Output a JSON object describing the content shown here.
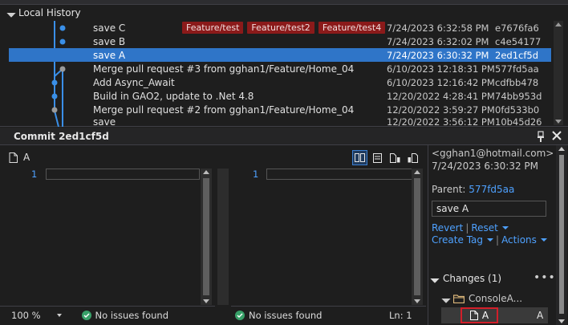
{
  "history": {
    "title": "Local History",
    "commits": [
      {
        "message": "save C",
        "tags": [
          "Feature/test",
          "Feature/test2",
          "Feature/test4"
        ],
        "date": "7/24/2023 6:32:58 PM",
        "sha": "e7676fa6",
        "selected": false
      },
      {
        "message": "save B",
        "tags": [],
        "date": "7/24/2023 6:32:02 PM",
        "sha": "c4e54177",
        "selected": false
      },
      {
        "message": "save A",
        "tags": [],
        "date": "7/24/2023 6:30:32 PM",
        "sha": "2ed1cf5d",
        "selected": true
      },
      {
        "message": "Merge pull request #3 from gghan1/Feature/Home_04",
        "tags": [],
        "date": "6/10/2023 12:18:31 PM",
        "sha": "577fd5aa",
        "selected": false
      },
      {
        "message": "Add Async_Await",
        "tags": [],
        "date": "6/10/2023 12:16:42 PM",
        "sha": "cdfbb478",
        "selected": false
      },
      {
        "message": "Build in GAO2, update to .Net 4.8",
        "tags": [],
        "date": "12/20/2022 4:28:41 PM",
        "sha": "74bb953d",
        "selected": false
      },
      {
        "message": "Merge pull request #2 from gghan1/Feature/Home_04",
        "tags": [],
        "date": "12/20/2022 3:59:27 PM",
        "sha": "0fd533b0",
        "selected": false
      },
      {
        "message": "save",
        "tags": [],
        "date": "12/20/2022 3:56:12 PM",
        "sha": "10b45d26",
        "selected": false
      }
    ]
  },
  "commit": {
    "title": "Commit 2ed1cf5d",
    "file_name": "A",
    "left_pane": {
      "line_number": "1"
    },
    "right_pane": {
      "line_number": "1"
    },
    "status_left": {
      "zoom": "100 %",
      "issues": "No issues found"
    },
    "status_right": {
      "issues": "No issues found",
      "position": "Ln: 1"
    },
    "details": {
      "author_email": "<gghan1@hotmail.com>",
      "date": "7/24/2023 6:30:32 PM",
      "parent_label": "Parent:",
      "parent_sha": "577fd5aa",
      "message": "save A",
      "revert": "Revert",
      "reset": "Reset",
      "create_tag": "Create Tag",
      "actions": "Actions",
      "changes_header": "Changes (1)",
      "more": "•••",
      "folder": "ConsoleA...",
      "file": "A",
      "file_status": "A"
    }
  },
  "colors": {
    "selection": "#2f75c8",
    "tag_bg": "#8b1a1a",
    "link": "#4ea1ff",
    "graph_line": "#3a8fe8",
    "highlight_box": "#d21f2a"
  }
}
